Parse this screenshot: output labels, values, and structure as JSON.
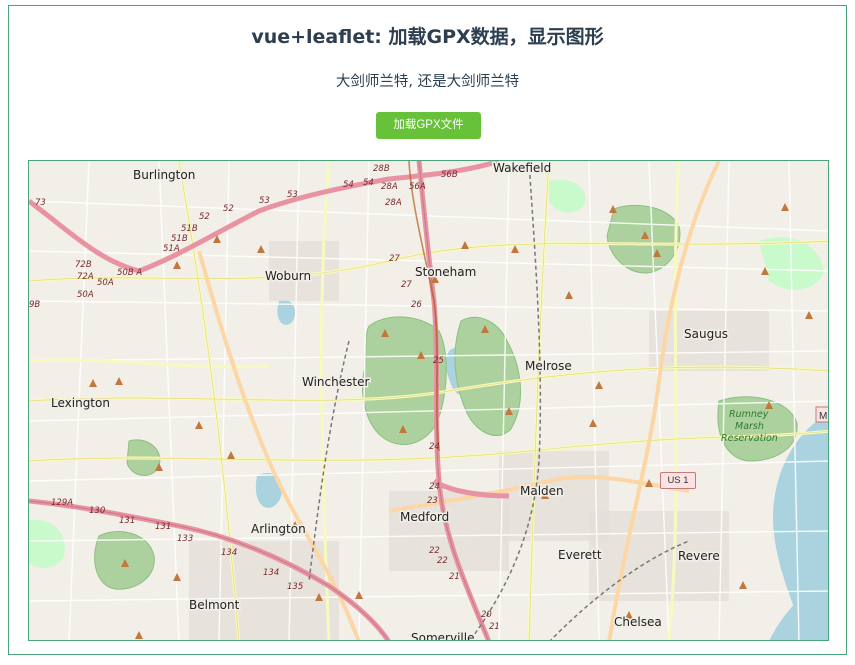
{
  "header": {
    "title": "vue+leaflet: 加载GPX数据，显示图形",
    "subtitle": "大剑师兰特, 还是大剑师兰特",
    "load_button_label": "加载GPX文件"
  },
  "map": {
    "place_labels": [
      {
        "id": "burlington",
        "text": "Burlington"
      },
      {
        "id": "wakefield",
        "text": "Wakefield"
      },
      {
        "id": "woburn",
        "text": "Woburn"
      },
      {
        "id": "stoneham",
        "text": "Stoneham"
      },
      {
        "id": "saugus",
        "text": "Saugus"
      },
      {
        "id": "melrose",
        "text": "Melrose"
      },
      {
        "id": "winchester",
        "text": "Winchester"
      },
      {
        "id": "lexington",
        "text": "Lexington"
      },
      {
        "id": "malden",
        "text": "Malden"
      },
      {
        "id": "medford",
        "text": "Medford"
      },
      {
        "id": "arlington",
        "text": "Arlington"
      },
      {
        "id": "everett",
        "text": "Everett"
      },
      {
        "id": "revere",
        "text": "Revere"
      },
      {
        "id": "belmont",
        "text": "Belmont"
      },
      {
        "id": "chelsea",
        "text": "Chelsea"
      },
      {
        "id": "somerville",
        "text": "Somerville"
      }
    ],
    "park_label": [
      "Rumney",
      "Marsh",
      "Reservation"
    ],
    "route_labels": [
      "73",
      "28B",
      "56B",
      "54",
      "54",
      "28A",
      "56A",
      "53",
      "52",
      "52",
      "53",
      "28A",
      "51B",
      "51B",
      "51A",
      "72B",
      "72A",
      "50A",
      "50B A",
      "50A",
      "27",
      "27",
      "26",
      "25",
      "24",
      "24",
      "23",
      "22",
      "22",
      "21",
      "20",
      "21",
      "9B",
      "129A",
      "130",
      "131",
      "131",
      "133",
      "134",
      "134",
      "135"
    ],
    "us_shield": "US 1",
    "edge_label": "M"
  }
}
